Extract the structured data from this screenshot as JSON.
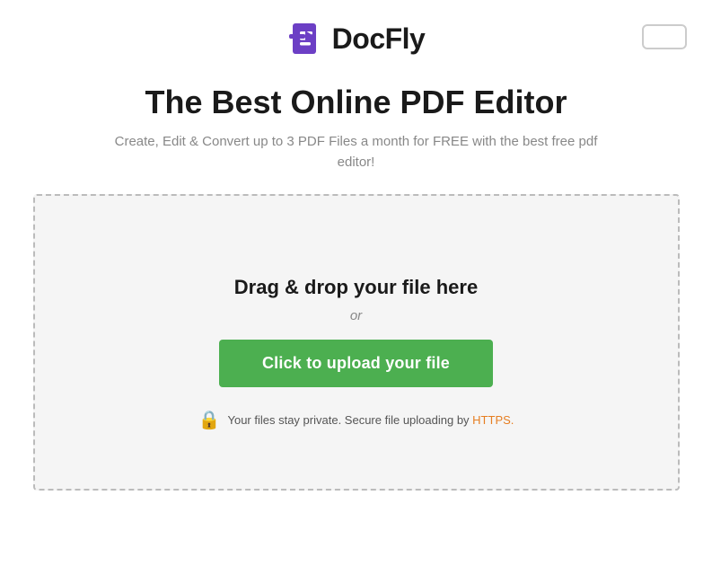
{
  "header": {
    "logo_text": "DocFly",
    "btn_label": ""
  },
  "hero": {
    "title": "The Best Online PDF Editor",
    "subtitle": "Create, Edit & Convert up to 3 PDF Files a month for FREE with the best free pdf editor!"
  },
  "upload": {
    "drag_drop_label": "Drag & drop your file here",
    "or_label": "or",
    "upload_btn_label": "Click to upload your file",
    "security_prefix": "Your files stay private. Secure file uploading by ",
    "security_link": "HTTPS.",
    "lock_icon": "🔒"
  }
}
